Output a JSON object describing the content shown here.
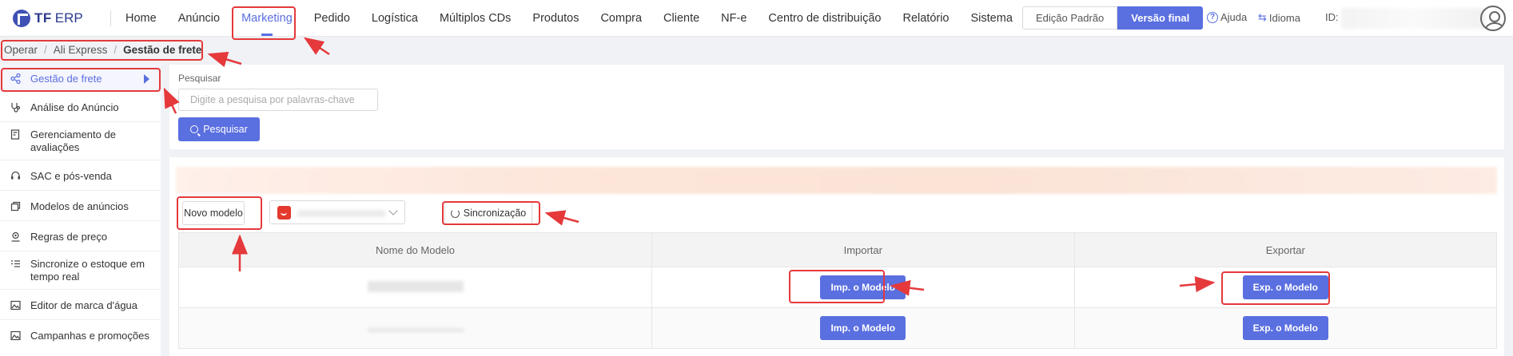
{
  "brand": {
    "mark": "TF",
    "name": "ERP"
  },
  "menu": [
    "Home",
    "Anúncio",
    "Marketing",
    "Pedido",
    "Logística",
    "Múltiplos CDs",
    "Produtos",
    "Compra",
    "Cliente",
    "NF-e",
    "Centro de distribuição",
    "Relatório",
    "Sistema"
  ],
  "menu_active": "Marketing",
  "edition": {
    "standard": "Edição Padrão",
    "final": "Versão final"
  },
  "header_links": {
    "help": "Ajuda",
    "language": "Idioma",
    "id_label": "ID:"
  },
  "breadcrumb": [
    "Operar",
    "Ali Express",
    "Gestão de frete"
  ],
  "sidebar": [
    {
      "label": "Gestão de frete",
      "icon": "share-nodes-icon",
      "active": true
    },
    {
      "label": "Análise do Anúncio",
      "icon": "stethoscope-icon"
    },
    {
      "label": "Gerenciamento de avaliações",
      "icon": "review-doc-icon"
    },
    {
      "label": "SAC e pós-venda",
      "icon": "headset-icon"
    },
    {
      "label": "Modelos de anúncios",
      "icon": "copy-icon"
    },
    {
      "label": "Regras de preço",
      "icon": "location-pin-icon"
    },
    {
      "label": "Sincronize o estoque em tempo real",
      "icon": "sync-list-icon"
    },
    {
      "label": "Editor de marca d'água",
      "icon": "image-icon"
    },
    {
      "label": "Campanhas e promoções",
      "icon": "promotion-icon"
    }
  ],
  "search": {
    "label": "Pesquisar",
    "placeholder": "Digite a pesquisa por palavras-chave",
    "button": "Pesquisar"
  },
  "toolbar": {
    "new_model": "Novo modelo",
    "sync": "Sincronização"
  },
  "table": {
    "headers": [
      "Nome do Modelo",
      "Importar",
      "Exportar"
    ],
    "rows": [
      {
        "import": "Imp. o Modelo",
        "export": "Exp. o Modelo"
      },
      {
        "import": "Imp. o Modelo",
        "export": "Exp. o Modelo"
      }
    ]
  },
  "colors": {
    "accent": "#5a6fe0",
    "annotation": "#e5393b",
    "aliexpress": "#e4392d"
  }
}
